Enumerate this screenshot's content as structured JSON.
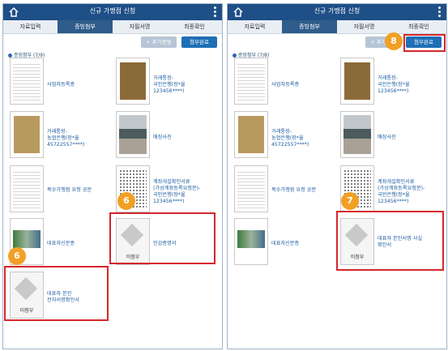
{
  "left": {
    "title": "신규 가맹점 신청",
    "steps": [
      "자료입력",
      "증빙첨부",
      "자필서명",
      "최종확인"
    ],
    "add_button": "+ 추가증빙",
    "done_button": "첨부완료",
    "count": "증빙첨부 (7/9)",
    "items": [
      "사업자등록증",
      "거래통장-\n국민은행(장*율\n123456****)",
      "거래통장-\n농협은행(장*율\n45722557****)",
      "매장사진",
      "복수가맹점 요청 공문",
      "계좌개설확인서류\n(가상계좌등록요청문)-\n국민은행(장*율\n123456****)",
      "대표자신분증",
      "인감증명서",
      "대표자 본인\n전자서명확인서"
    ],
    "missing_label": "미첨부",
    "badges": [
      "6",
      "6"
    ]
  },
  "right": {
    "title": "신규 가맹점 신청",
    "steps": [
      "자료입력",
      "증빙첨부",
      "자필서명",
      "최종확인"
    ],
    "add_button": "+ 추가증빙",
    "done_button": "첨부완료",
    "count": "증빙첨부 (7/8)",
    "items": [
      "사업자등록증",
      "거래통장-\n국민은행(장*율\n123456****)",
      "거래통장-\n농협은행(장*율\n45722557****)",
      "매장사진",
      "복수가맹점 요청 공문",
      "계좌개설확인서류\n(가상계좌등록요청문)-\n국민은행(장*율\n123456****)",
      "대표자신분증",
      "대표자 본인서명 사실\n확인서"
    ],
    "missing_label": "미첨부",
    "badges": [
      "7",
      "8"
    ]
  }
}
